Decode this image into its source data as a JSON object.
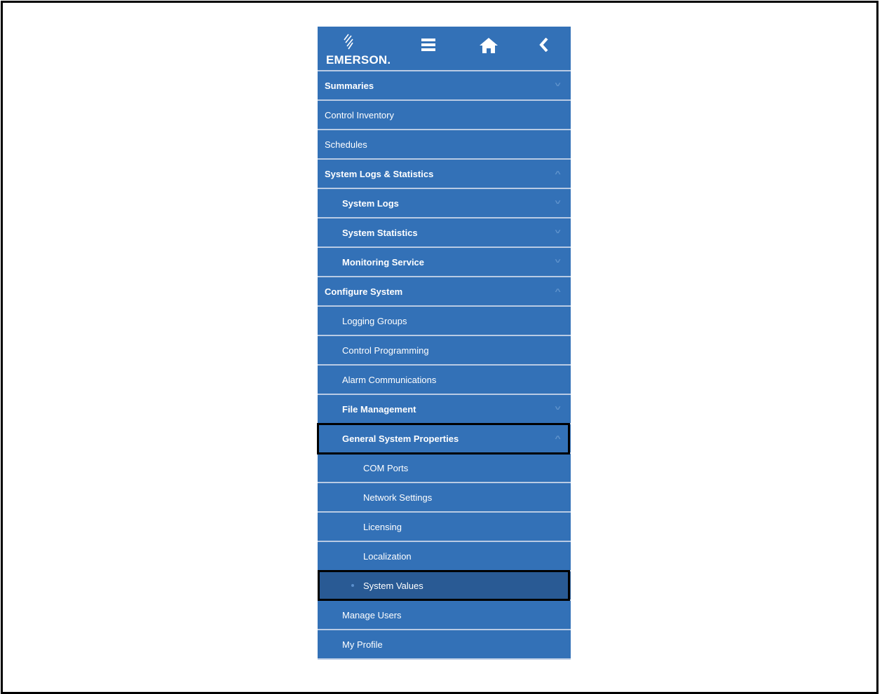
{
  "header": {
    "logo_text": "EMERSON",
    "logo_suffix": ".",
    "icons": [
      "hamburger-icon",
      "home-icon",
      "back-chevron-icon"
    ]
  },
  "menu": {
    "items": [
      {
        "label": "Summaries",
        "level": 0,
        "bold": true,
        "caret": "down"
      },
      {
        "label": "Control Inventory",
        "level": 0,
        "bold": false,
        "caret": ""
      },
      {
        "label": "Schedules",
        "level": 0,
        "bold": false,
        "caret": ""
      },
      {
        "label": "System Logs & Statistics",
        "level": 0,
        "bold": true,
        "caret": "up"
      },
      {
        "label": "System Logs",
        "level": 1,
        "bold": true,
        "caret": "down"
      },
      {
        "label": "System Statistics",
        "level": 1,
        "bold": true,
        "caret": "down"
      },
      {
        "label": "Monitoring Service",
        "level": 1,
        "bold": true,
        "caret": "down"
      },
      {
        "label": "Configure System",
        "level": 0,
        "bold": true,
        "caret": "up"
      },
      {
        "label": "Logging Groups",
        "level": 1,
        "bold": false,
        "caret": ""
      },
      {
        "label": "Control Programming",
        "level": 1,
        "bold": false,
        "caret": ""
      },
      {
        "label": "Alarm Communications",
        "level": 1,
        "bold": false,
        "caret": ""
      },
      {
        "label": "File Management",
        "level": 1,
        "bold": true,
        "caret": "down"
      },
      {
        "label": "General System Properties",
        "level": 1,
        "bold": true,
        "caret": "up"
      },
      {
        "label": "COM Ports",
        "level": 2,
        "bold": false,
        "caret": ""
      },
      {
        "label": "Network Settings",
        "level": 2,
        "bold": false,
        "caret": ""
      },
      {
        "label": "Licensing",
        "level": 2,
        "bold": false,
        "caret": ""
      },
      {
        "label": "Localization",
        "level": 2,
        "bold": false,
        "caret": ""
      },
      {
        "label": "System Values",
        "level": 2,
        "bold": false,
        "caret": "",
        "selected": true
      },
      {
        "label": "Manage Users",
        "level": 1,
        "bold": false,
        "caret": ""
      },
      {
        "label": "My Profile",
        "level": 1,
        "bold": false,
        "caret": ""
      }
    ]
  },
  "colors": {
    "menu_bg": "#3371b7",
    "divider": "#b9cbe4",
    "selected_bg": "#295a94",
    "caret": "#5f93cc",
    "highlight_border": "#000000"
  }
}
